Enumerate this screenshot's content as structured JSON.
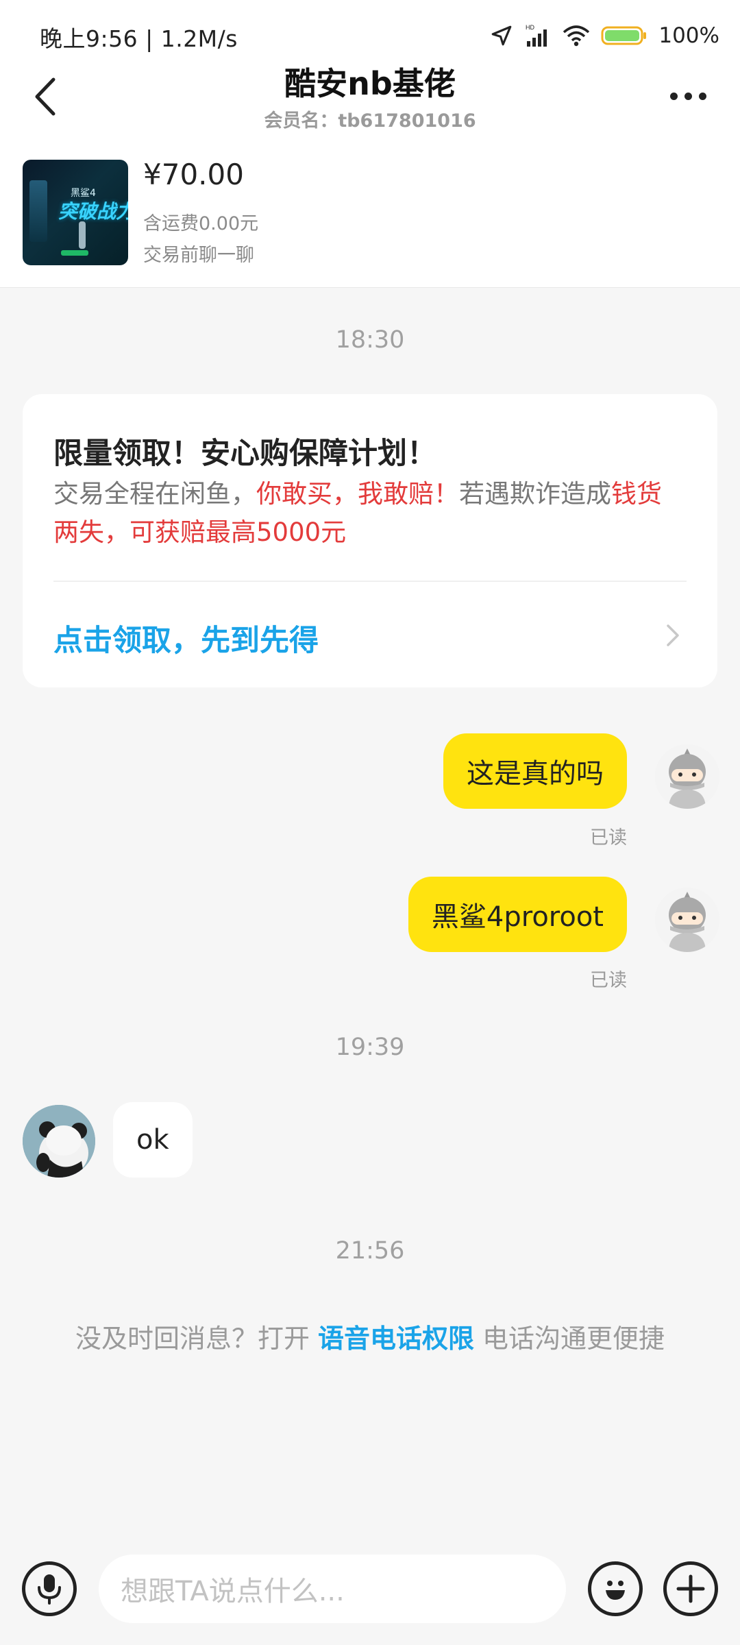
{
  "status_bar": {
    "time_speed": "晚上9:56 | 1.2M/s",
    "battery": "100%"
  },
  "header": {
    "title": "酷安nb基佬",
    "subtitle": "会员名：tb617801016"
  },
  "product": {
    "price": "¥70.00",
    "shipping": "含运费0.00元",
    "note": "交易前聊一聊",
    "thumb_small": "黑鲨4",
    "thumb_big": "突破战力"
  },
  "timestamps": {
    "t1": "18:30",
    "t2": "19:39",
    "t3": "21:56"
  },
  "card": {
    "title": "限量领取！安心购保障计划！",
    "body_1": "交易全程在闲鱼，",
    "body_2": "你敢买，我敢赔！",
    "body_3": "若遇欺诈造成",
    "body_4": "钱货两失，可获赔最高5000元",
    "link": "点击领取，先到先得"
  },
  "messages": {
    "m1": "这是真的吗",
    "m1_status": "已读",
    "m2": "黑鲨4proroot",
    "m2_status": "已读",
    "m3": "ok"
  },
  "voice_tip": {
    "prefix": "没及时回消息？打开",
    "link": "语音电话权限",
    "suffix": "电话沟通更便捷"
  },
  "input": {
    "placeholder": "想跟TA说点什么..."
  },
  "colors": {
    "bubble_out": "#ffe30f",
    "link_blue": "#1aa3e8",
    "highlight_red": "#e33b3b"
  }
}
